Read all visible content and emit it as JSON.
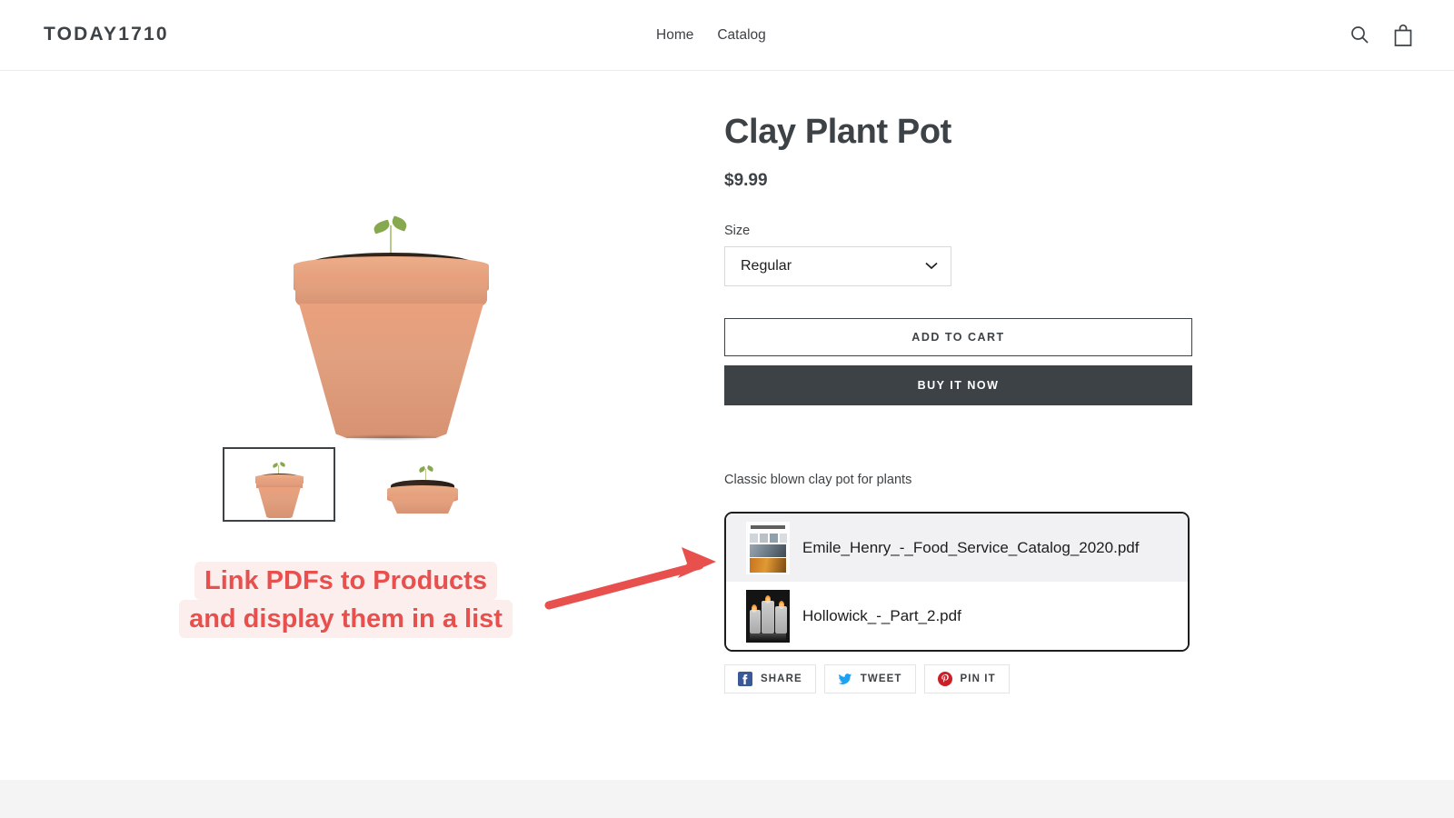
{
  "header": {
    "brand": "TODAY1710",
    "nav": [
      {
        "label": "Home"
      },
      {
        "label": "Catalog"
      }
    ],
    "icons": [
      {
        "name": "search-icon",
        "label": "Search"
      },
      {
        "name": "cart-icon",
        "label": "Cart"
      }
    ]
  },
  "product": {
    "title": "Clay Plant Pot",
    "price": "$9.99",
    "option_label": "Size",
    "option_value": "Regular",
    "option_choices": [
      "Regular"
    ],
    "add_to_cart_label": "ADD TO CART",
    "buy_now_label": "BUY IT NOW",
    "description": "Classic blown clay pot for plants"
  },
  "gallery": {
    "thumbnails": [
      {
        "name": "clay-pot-front",
        "selected": true
      },
      {
        "name": "clay-pot-top",
        "selected": false
      }
    ]
  },
  "pdf_list": {
    "items": [
      {
        "filename": "Emile_Henry_-_Food_Service_Catalog_2020.pdf",
        "thumbnail": "catalog-cover-thumbnail",
        "highlighted": true
      },
      {
        "filename": "Hollowick_-_Part_2.pdf",
        "thumbnail": "candle-holders-thumbnail",
        "highlighted": false
      }
    ]
  },
  "share": {
    "buttons": [
      {
        "label": "SHARE",
        "icon": "facebook-icon",
        "color": "#3b5998"
      },
      {
        "label": "TWEET",
        "icon": "twitter-icon",
        "color": "#1da1f2"
      },
      {
        "label": "PIN IT",
        "icon": "pinterest-icon",
        "color": "#cb2027"
      }
    ]
  },
  "annotation": {
    "line1": "Link PDFs to Products",
    "line2": "and display them in a list",
    "color": "#e8504e",
    "background": "#fdeeee"
  },
  "colors": {
    "text": "#3d4246",
    "dark_button": "#3d4246",
    "border": "#ebebeb",
    "footer_band": "#f4f4f4",
    "pdf_row_highlight": "#f1f1f4"
  }
}
